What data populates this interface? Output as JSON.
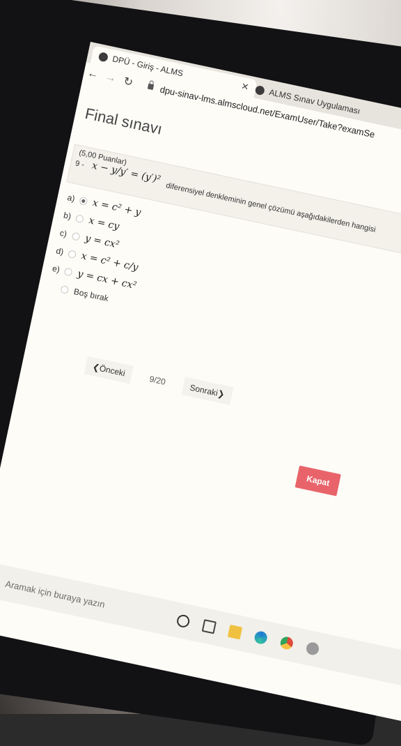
{
  "browser": {
    "tabs": [
      {
        "label": "DPÜ - Giriş - ALMS",
        "icon": "globe-icon",
        "close": "✕"
      },
      {
        "label": "ALMS Sınav Uygulaması",
        "icon": "globe-icon"
      }
    ],
    "nav": {
      "back": "←",
      "forward": "→",
      "reload": "↻"
    },
    "url": "dpu-sinav-lms.almscloud.net/ExamUser/Take?examSe"
  },
  "page": {
    "title": "Final sınavı",
    "question": {
      "points": "(5,00 Puanlar)",
      "number": "9 -",
      "formula": "x − y/y′ = (y′)²",
      "text": "diferensiyel denkleminin genel çözümü aşağıdakilerden hangisi"
    },
    "options": [
      {
        "letter": "a)",
        "math": "x = c² + y",
        "selected": true
      },
      {
        "letter": "b)",
        "math": "x = cy",
        "selected": false
      },
      {
        "letter": "c)",
        "math": "y = cx²",
        "selected": false
      },
      {
        "letter": "d)",
        "math": "x = c² + c/y",
        "selected": false
      },
      {
        "letter": "e)",
        "math": "y = cx + cx²",
        "selected": false
      }
    ],
    "blank_option": "Boş bırak",
    "pager": {
      "prev": "❮Önceki",
      "count": "9/20",
      "next": "Sonraki❯"
    },
    "close_button": "Kapat"
  },
  "taskbar": {
    "search_placeholder": "Aramak için buraya yazın",
    "icons": [
      "cortana-icon",
      "task-view-icon",
      "file-explorer-icon",
      "edge-icon",
      "chrome-icon",
      "chrome-profile-icon"
    ]
  }
}
